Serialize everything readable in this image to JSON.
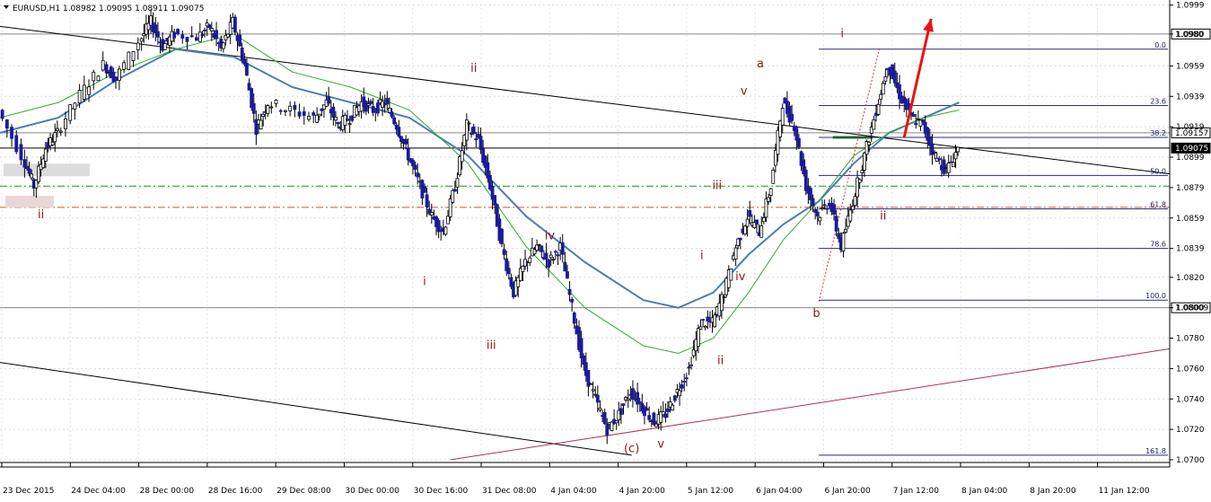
{
  "chart_data": {
    "type": "candlestick",
    "symbol_header": "EURUSD,H1  1.08982 1.09095 1.08911 1.09075",
    "ylim": [
      1.07,
      1.1
    ],
    "y_ticks": [
      "1.0999",
      "1.0980",
      "1.0959",
      "1.0939",
      "1.0919",
      "1.0899",
      "1.0879",
      "1.0859",
      "1.0839",
      "1.0820",
      "1.0800",
      "1.0780",
      "1.0760",
      "1.0740",
      "1.0720",
      "1.0700"
    ],
    "y_tick_values": [
      1.0999,
      1.098,
      1.0959,
      1.0939,
      1.0919,
      1.0899,
      1.0879,
      1.0859,
      1.0839,
      1.082,
      1.08,
      1.078,
      1.076,
      1.074,
      1.072,
      1.07
    ],
    "x_labels": [
      "23 Dec 2015",
      "24 Dec 04:00",
      "28 Dec 00:00",
      "28 Dec 16:00",
      "29 Dec 08:00",
      "30 Dec 00:00",
      "30 Dec 16:00",
      "31 Dec 08:00",
      "4 Jan 04:00",
      "4 Jan 20:00",
      "5 Jan 12:00",
      "6 Jan 04:00",
      "6 Jan 20:00",
      "7 Jan 12:00",
      "8 Jan 04:00",
      "8 Jan 20:00",
      "11 Jan 12:00"
    ],
    "x_range": [
      0,
      100
    ],
    "grid": true,
    "price_path": [
      [
        0,
        1.093
      ],
      [
        2,
        1.09
      ],
      [
        3,
        1.088
      ],
      [
        4,
        1.0905
      ],
      [
        5,
        1.0915
      ],
      [
        7,
        1.094
      ],
      [
        9,
        1.096
      ],
      [
        10,
        1.095
      ],
      [
        12,
        1.0975
      ],
      [
        13,
        1.0988
      ],
      [
        14,
        1.0972
      ],
      [
        15,
        1.098
      ],
      [
        17,
        1.0978
      ],
      [
        18,
        1.0985
      ],
      [
        19,
        1.097
      ],
      [
        20,
        1.0988
      ],
      [
        21,
        1.096
      ],
      [
        22,
        1.0918
      ],
      [
        23,
        1.0935
      ],
      [
        25,
        1.093
      ],
      [
        27,
        1.0925
      ],
      [
        28,
        1.0935
      ],
      [
        29,
        1.092
      ],
      [
        30,
        1.0925
      ],
      [
        31,
        1.0935
      ],
      [
        32,
        1.093
      ],
      [
        33,
        1.0935
      ],
      [
        34,
        1.092
      ],
      [
        35,
        1.09
      ],
      [
        36,
        1.088
      ],
      [
        37,
        1.086
      ],
      [
        38,
        1.085
      ],
      [
        39,
        1.088
      ],
      [
        40,
        1.092
      ],
      [
        41,
        1.091
      ],
      [
        42,
        1.088
      ],
      [
        43,
        1.084
      ],
      [
        44,
        1.081
      ],
      [
        45,
        1.083
      ],
      [
        46,
        1.084
      ],
      [
        47,
        1.083
      ],
      [
        48,
        1.084
      ],
      [
        49,
        1.08
      ],
      [
        50,
        1.076
      ],
      [
        51,
        1.074
      ],
      [
        52,
        1.072
      ],
      [
        53,
        1.073
      ],
      [
        54,
        1.0745
      ],
      [
        55,
        1.0735
      ],
      [
        56,
        1.0725
      ],
      [
        57,
        1.073
      ],
      [
        58,
        1.0745
      ],
      [
        59,
        1.076
      ],
      [
        60,
        1.079
      ],
      [
        61,
        1.079
      ],
      [
        62,
        1.081
      ],
      [
        63,
        1.084
      ],
      [
        64,
        1.086
      ],
      [
        65,
        1.085
      ],
      [
        66,
        1.088
      ],
      [
        67,
        1.0935
      ],
      [
        68,
        1.092
      ],
      [
        69,
        1.088
      ],
      [
        70,
        1.086
      ],
      [
        71,
        1.087
      ],
      [
        72,
        1.084
      ],
      [
        73,
        1.087
      ],
      [
        74,
        1.09
      ],
      [
        75,
        1.093
      ],
      [
        76,
        1.096
      ],
      [
        77,
        1.094
      ],
      [
        78,
        1.0925
      ],
      [
        79,
        1.092
      ],
      [
        80,
        1.09
      ],
      [
        81,
        1.089
      ],
      [
        82,
        1.0905
      ]
    ],
    "series": [
      {
        "values": [
          [
            0,
            1.0915
          ],
          [
            5,
            1.0925
          ],
          [
            10,
            1.095
          ],
          [
            15,
            1.097
          ],
          [
            20,
            1.0965
          ],
          [
            25,
            1.0945
          ],
          [
            30,
            1.0935
          ],
          [
            35,
            1.0925
          ],
          [
            40,
            1.09
          ],
          [
            45,
            1.086
          ],
          [
            50,
            1.083
          ],
          [
            55,
            1.0805
          ],
          [
            58,
            1.08
          ],
          [
            61,
            1.081
          ],
          [
            64,
            1.0835
          ],
          [
            67,
            1.0855
          ],
          [
            70,
            1.087
          ],
          [
            73,
            1.0895
          ],
          [
            76,
            1.0915
          ],
          [
            79,
            1.0925
          ],
          [
            82,
            1.0935
          ]
        ],
        "color": "#4a7fb0"
      },
      {
        "values": [
          [
            0,
            1.0925
          ],
          [
            5,
            1.0935
          ],
          [
            10,
            1.0955
          ],
          [
            15,
            1.097
          ],
          [
            20,
            1.098
          ],
          [
            25,
            1.0955
          ],
          [
            30,
            1.0945
          ],
          [
            35,
            1.093
          ],
          [
            40,
            1.0895
          ],
          [
            45,
            1.084
          ],
          [
            50,
            1.08
          ],
          [
            55,
            1.0775
          ],
          [
            58,
            1.077
          ],
          [
            61,
            1.078
          ],
          [
            64,
            1.081
          ],
          [
            67,
            1.0845
          ],
          [
            70,
            1.087
          ],
          [
            73,
            1.09
          ],
          [
            76,
            1.0915
          ],
          [
            79,
            1.0925
          ],
          [
            82,
            1.093
          ]
        ],
        "color": "#33aa33"
      }
    ],
    "h_levels": [
      {
        "price": 1.098,
        "label": "1.0980",
        "color": "#888888"
      },
      {
        "price": 1.0915,
        "label": "1.09157",
        "color": "#888888"
      },
      {
        "price": 1.08,
        "label": "1.08009",
        "color": "#888888"
      },
      {
        "price": 1.0905,
        "label": "1.09075",
        "color": "#000000",
        "current": true
      }
    ],
    "dashed_levels": [
      {
        "price": 1.088,
        "color": "#2a8a2a"
      },
      {
        "price": 1.0866,
        "color": "#d2541e"
      }
    ],
    "fib_levels": [
      {
        "label": "0.0",
        "price": 1.097
      },
      {
        "label": "23.6",
        "price": 1.0933
      },
      {
        "label": "38.2",
        "price": 1.0912
      },
      {
        "label": "50.0",
        "price": 1.0887
      },
      {
        "label": "61.8",
        "price": 1.0865
      },
      {
        "label": "78.6",
        "price": 1.0839
      },
      {
        "label": "100.0",
        "price": 1.0805
      },
      {
        "label": "161.8",
        "price": 1.0703
      }
    ],
    "fib_x_start": 70,
    "wave_labels": [
      {
        "text": "ii",
        "x": 3.5,
        "price": 1.0859
      },
      {
        "text": "ii",
        "x": 40.5,
        "price": 1.0955
      },
      {
        "text": "i",
        "x": 36.3,
        "price": 1.0815
      },
      {
        "text": "iii",
        "x": 42,
        "price": 1.0773
      },
      {
        "text": "iv",
        "x": 47,
        "price": 1.0845
      },
      {
        "text": "(c)",
        "x": 54,
        "price": 1.0705
      },
      {
        "text": "v",
        "x": 56.5,
        "price": 1.0708
      },
      {
        "text": "a",
        "x": 65,
        "price": 1.0958
      },
      {
        "text": "v",
        "x": 63.6,
        "price": 1.094
      },
      {
        "text": "iii",
        "x": 61.3,
        "price": 1.0878
      },
      {
        "text": "i",
        "x": 60,
        "price": 1.0832
      },
      {
        "text": "iv",
        "x": 63.3,
        "price": 1.0818
      },
      {
        "text": "ii",
        "x": 61.6,
        "price": 1.0763
      },
      {
        "text": "b",
        "x": 69.8,
        "price": 1.0794
      },
      {
        "text": "i",
        "x": 72,
        "price": 1.0978
      },
      {
        "text": "ii",
        "x": 75.5,
        "price": 1.0858
      }
    ],
    "trend_lines": [
      {
        "from": [
          0,
          1.0985
        ],
        "to": [
          100,
          1.0888
        ],
        "color": "#000000"
      },
      {
        "from": [
          0,
          1.0764
        ],
        "to": [
          54,
          1.0703
        ],
        "color": "#000000"
      },
      {
        "from": [
          38.5,
          1.07
        ],
        "to": [
          100,
          1.0773
        ],
        "color": "#b03050"
      }
    ],
    "arrow": {
      "from": [
        77.3,
        1.0912
      ],
      "to": [
        79.6,
        1.099
      ],
      "color": "#ee1111"
    }
  }
}
